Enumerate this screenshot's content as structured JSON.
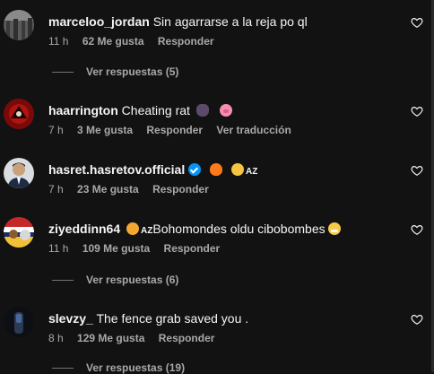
{
  "comments": [
    {
      "username": "marceloo_jordan",
      "text": "Sin agarrarse a la reja po ql",
      "time": "11 h",
      "likes": "62 Me gusta",
      "reply": "Responder",
      "replies_label": "Ver respuestas (5)"
    },
    {
      "username": "haarrington",
      "text": "Cheating rat",
      "time": "7 h",
      "likes": "3 Me gusta",
      "reply": "Responder",
      "translate": "Ver traducción",
      "emojis": [
        "rat-emoji",
        "pig-face-emoji"
      ]
    },
    {
      "username": "hasret.hasretov.official",
      "text": "",
      "time": "7 h",
      "likes": "23 Me gusta",
      "reply": "Responder",
      "verified": true,
      "emojis": [
        "fire-emoji",
        "flexed-biceps-emoji"
      ],
      "suffix": "AZ"
    },
    {
      "username": "ziyeddinn64",
      "prefix": "AZ",
      "text": "Bohomondes oldu cibobombes",
      "time": "11 h",
      "likes": "109 Me gusta",
      "reply": "Responder",
      "replies_label": "Ver respuestas (6)",
      "emojis": [
        "lion-emoji",
        "grinning-face-emoji"
      ]
    },
    {
      "username": "slevzy_",
      "text": "The fence grab saved you .",
      "time": "8 h",
      "likes": "129 Me gusta",
      "reply": "Responder",
      "replies_label": "Ver respuestas (19)"
    }
  ],
  "colors": {
    "background": "#121212",
    "text_primary": "#f5f5f5",
    "text_secondary": "#a8a8a8",
    "verified_blue": "#0095f6"
  }
}
